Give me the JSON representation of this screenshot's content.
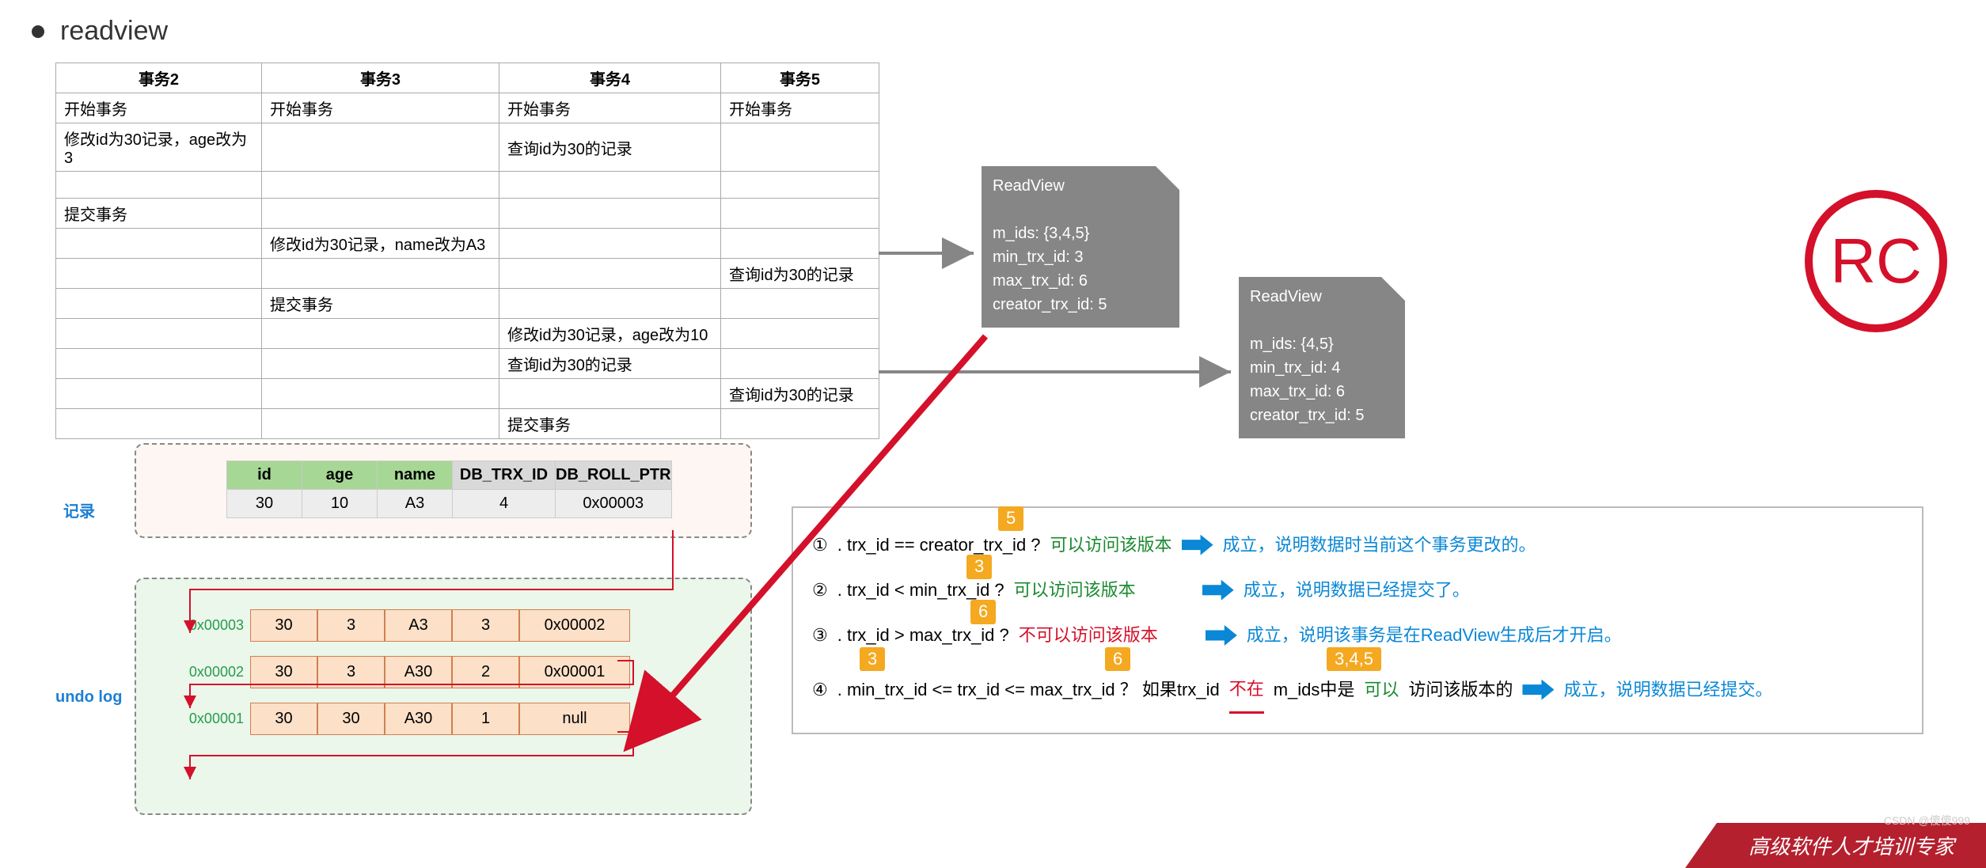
{
  "title": "readview",
  "trx_table": {
    "headers": [
      "事务2",
      "事务3",
      "事务4",
      "事务5"
    ],
    "rows": [
      [
        "开始事务",
        "开始事务",
        "开始事务",
        "开始事务"
      ],
      [
        "修改id为30记录，age改为3",
        "",
        "查询id为30的记录",
        ""
      ],
      [
        "",
        "",
        "",
        ""
      ],
      [
        "提交事务",
        "",
        "",
        ""
      ],
      [
        "",
        "修改id为30记录，name改为A3",
        "",
        ""
      ],
      [
        "",
        "",
        "",
        "查询id为30的记录"
      ],
      [
        "",
        "提交事务",
        "",
        ""
      ],
      [
        "",
        "",
        "修改id为30记录，age改为10",
        ""
      ],
      [
        "",
        "",
        "查询id为30的记录",
        ""
      ],
      [
        "",
        "",
        "",
        "查询id为30的记录"
      ],
      [
        "",
        "",
        "提交事务",
        ""
      ]
    ]
  },
  "readview1": {
    "title": "ReadView",
    "m_ids": "m_ids: {3,4,5}",
    "min": "min_trx_id: 3",
    "max": "max_trx_id: 6",
    "creator": "creator_trx_id: 5"
  },
  "readview2": {
    "title": "ReadView",
    "m_ids": "m_ids: {4,5}",
    "min": "min_trx_id: 4",
    "max": "max_trx_id: 6",
    "creator": "creator_trx_id: 5"
  },
  "rc_badge": "RC",
  "labels": {
    "record": "记录",
    "undo": "undo log"
  },
  "record_table": {
    "headers": [
      "id",
      "age",
      "name",
      "DB_TRX_ID",
      "DB_ROLL_PTR"
    ],
    "row": [
      "30",
      "10",
      "A3",
      "4",
      "0x00003"
    ]
  },
  "undo_rows": [
    {
      "ptr": "0x00003",
      "cells": [
        "30",
        "3",
        "A3",
        "3",
        "0x00002"
      ]
    },
    {
      "ptr": "0x00002",
      "cells": [
        "30",
        "3",
        "A30",
        "2",
        "0x00001"
      ]
    },
    {
      "ptr": "0x00001",
      "cells": [
        "30",
        "30",
        "A30",
        "1",
        "null"
      ]
    }
  ],
  "rules": {
    "r1": {
      "num": "①",
      "txt": ". trx_id  == creator_trx_id ? ",
      "ok": "可以访问该版本",
      "tag": "5",
      "desc": "成立，说明数据时当前这个事务更改的。"
    },
    "r2": {
      "num": "②",
      "txt": ". trx_id < min_trx_id ? ",
      "ok": "可以访问该版本",
      "tag": "3",
      "desc": "成立，说明数据已经提交了。"
    },
    "r3": {
      "num": "③",
      "txt": ". trx_id > max_trx_id ? ",
      "no": "不可以访问该版本",
      "tag": "6",
      "desc": "成立，说明该事务是在ReadView生成后才开启。"
    },
    "r4": {
      "num": "④",
      "txt1": ". min_trx_id <= trx_id <= max_trx_id ？ 如果trx_id",
      "not": "不在",
      "txt2": "m_ids中是",
      "ok": "可以",
      "txt3": "访问该版本的",
      "tag1": "3",
      "tag2": "6",
      "tag3": "3,4,5",
      "desc": "成立，说明数据已经提交。"
    }
  },
  "footer": "高级软件人才培训专家",
  "watermark": "CSDN @傻傻999"
}
